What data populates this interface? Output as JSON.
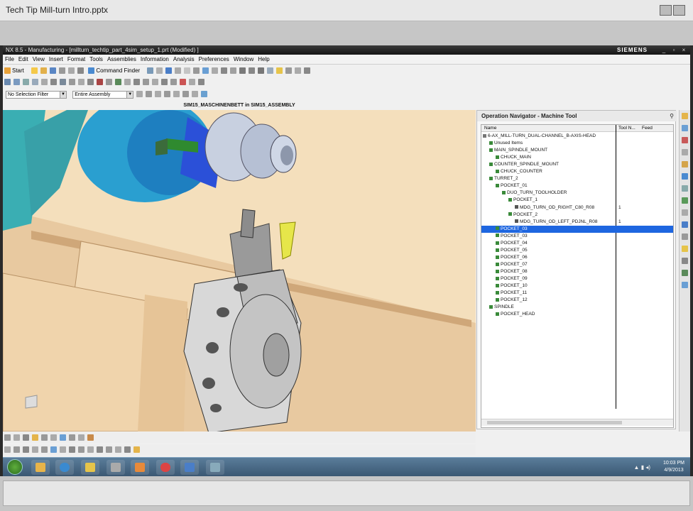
{
  "outer": {
    "title": "Tech Tip Mill-turn Intro.pptx"
  },
  "nx": {
    "title": "NX 8.5 - Manufacturing - [millturn_techtip_part_4sim_setup_1.prt (Modified) ]",
    "brand": "SIEMENS",
    "menu": [
      "File",
      "Edit",
      "View",
      "Insert",
      "Format",
      "Tools",
      "Assemblies",
      "Information",
      "Analysis",
      "Preferences",
      "Window",
      "Help"
    ],
    "toolbar": {
      "start_label": "Start",
      "command_finder_label": "Command Finder"
    },
    "filters": {
      "selection_filter": "No Selection Filter",
      "assembly_scope": "Entire Assembly"
    },
    "view_label": "SIM15_MASCHINENBETT in SIM15_ASSEMBLY"
  },
  "navigator": {
    "title": "Operation Navigator - Machine Tool",
    "columns": {
      "name": "Name",
      "tool_number": "Tool N...",
      "feed": "Feed"
    },
    "rows": [
      {
        "label": "6-AX_MILL-TURN_DUAL-CHANNEL_B-AXIS-HEAD",
        "indent": 0,
        "value": ""
      },
      {
        "label": "Unused Items",
        "indent": 1,
        "value": ""
      },
      {
        "label": "MAIN_SPINDLE_MOUNT",
        "indent": 1,
        "value": ""
      },
      {
        "label": "CHUCK_MAIN",
        "indent": 2,
        "value": ""
      },
      {
        "label": "COUNTER_SPINDLE_MOUNT",
        "indent": 1,
        "value": ""
      },
      {
        "label": "CHUCK_COUNTER",
        "indent": 2,
        "value": ""
      },
      {
        "label": "TURRET_2",
        "indent": 1,
        "value": ""
      },
      {
        "label": "POCKET_01",
        "indent": 2,
        "value": ""
      },
      {
        "label": "DUO_TURN_TOOLHOLDER",
        "indent": 3,
        "value": ""
      },
      {
        "label": "POCKET_1",
        "indent": 4,
        "value": ""
      },
      {
        "label": "MDG_TURN_OD_RIGHT_C80_R08",
        "indent": 5,
        "value": "1"
      },
      {
        "label": "POCKET_2",
        "indent": 4,
        "value": ""
      },
      {
        "label": "MDG_TURN_OD_LEFT_PDJNL_R08",
        "indent": 5,
        "value": "1"
      },
      {
        "label": "POCKET_03",
        "indent": 2,
        "value": "",
        "selected": true
      },
      {
        "label": "POCKET_03",
        "indent": 2,
        "value": ""
      },
      {
        "label": "POCKET_04",
        "indent": 2,
        "value": ""
      },
      {
        "label": "POCKET_05",
        "indent": 2,
        "value": ""
      },
      {
        "label": "POCKET_06",
        "indent": 2,
        "value": ""
      },
      {
        "label": "POCKET_07",
        "indent": 2,
        "value": ""
      },
      {
        "label": "POCKET_08",
        "indent": 2,
        "value": ""
      },
      {
        "label": "POCKET_09",
        "indent": 2,
        "value": ""
      },
      {
        "label": "POCKET_10",
        "indent": 2,
        "value": ""
      },
      {
        "label": "POCKET_11",
        "indent": 2,
        "value": ""
      },
      {
        "label": "POCKET_12",
        "indent": 2,
        "value": ""
      },
      {
        "label": "SPINDLE",
        "indent": 1,
        "value": ""
      },
      {
        "label": "POCKET_HEAD",
        "indent": 2,
        "value": ""
      }
    ]
  },
  "taskbar": {
    "time": "10:03 PM",
    "date": "4/9/2013"
  },
  "colors": {
    "viewport_bg": "#f6e4c6",
    "selection": "#1e66e0",
    "machine_teal": "#3aaeb3",
    "part_blue": "#2f6fd0"
  }
}
